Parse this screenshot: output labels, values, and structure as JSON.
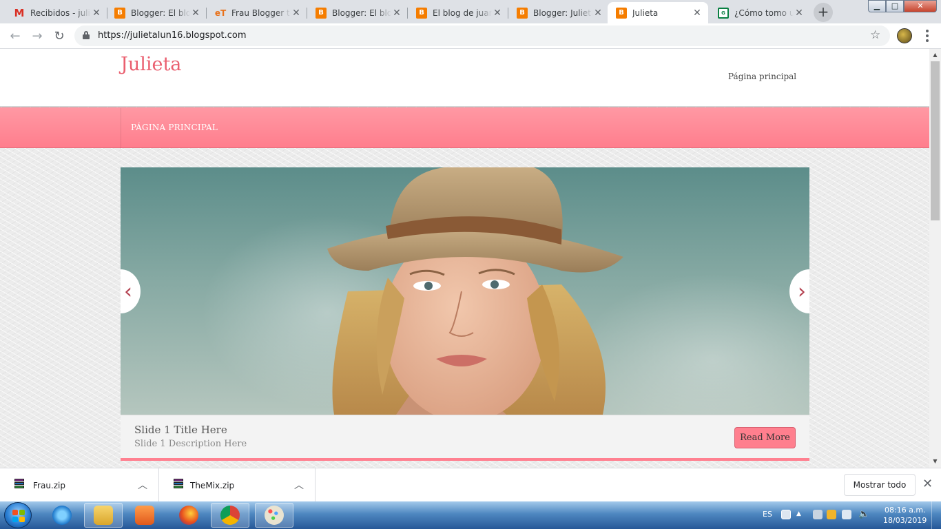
{
  "browser": {
    "tabs": [
      {
        "title": "Recibidos - julieta",
        "icon": "gmail-icon",
        "active": false
      },
      {
        "title": "Blogger: El blog de juan",
        "icon": "blogger-icon",
        "active": false
      },
      {
        "title": "Frau Blogger template",
        "icon": "et-icon",
        "active": false
      },
      {
        "title": "Blogger: El blog de juan",
        "icon": "blogger-icon",
        "active": false
      },
      {
        "title": "El blog de juan",
        "icon": "blogger-icon",
        "active": false
      },
      {
        "title": "Blogger: Julieta",
        "icon": "blogger-icon",
        "active": false
      },
      {
        "title": "Julieta",
        "icon": "blogger-icon",
        "active": true
      },
      {
        "title": "¿Cómo tomo un",
        "icon": "guide-icon",
        "active": false
      }
    ],
    "new_tab_glyph": "+",
    "close_glyph": "✕",
    "back_glyph": "←",
    "forward_glyph": "→",
    "reload_glyph": "↻",
    "url": "https://julietalun16.blogspot.com",
    "star_glyph": "☆",
    "window_buttons": {
      "min": "▁",
      "max": "□",
      "close": "✕"
    }
  },
  "page": {
    "site_title": "Julieta",
    "header_link": "Página principal",
    "nav_items": [
      "PÁGINA PRINCIPAL"
    ],
    "slider": {
      "prev_glyph": "‹",
      "next_glyph": "›",
      "slide_title": "Slide 1 Title Here",
      "slide_description": "Slide 1 Description Here",
      "read_more": "Read More"
    },
    "accent_color": "#ff7f8e",
    "title_color": "#ea5f6f"
  },
  "downloads": {
    "items": [
      {
        "name": "Frau.zip",
        "chevron": "︿"
      },
      {
        "name": "TheMix.zip",
        "chevron": "︿"
      }
    ],
    "show_all": "Mostrar todo",
    "close_glyph": "✕"
  },
  "taskbar": {
    "language": "ES",
    "time": "08:16 a.m.",
    "date": "18/03/2019",
    "tray_arrow": "▲",
    "pinned": [
      "internet-explorer-icon",
      "file-explorer-icon",
      "media-player-icon",
      "firefox-icon",
      "chrome-icon",
      "paint-icon"
    ]
  }
}
